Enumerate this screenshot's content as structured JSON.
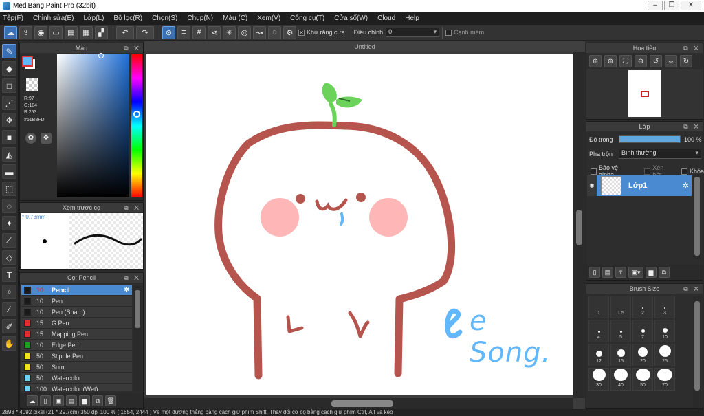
{
  "window": {
    "title": "MediBang Paint Pro (32bit)",
    "minimize": "–",
    "maximize": "❐",
    "close": "✕"
  },
  "menu": [
    "Tệp(F)",
    "Chỉnh sửa(E)",
    "Lớp(L)",
    "Bộ lọc(R)",
    "Chọn(S)",
    "Chụp(N)",
    "Màu (C)",
    "Xem(V)",
    "Công cụ(T)",
    "Cửa sổ(W)",
    "Cloud",
    "Help"
  ],
  "toolbar": {
    "antialias_label": "Khử răng cưa",
    "adjust_label": "Điều chỉnh",
    "adjust_value": "0",
    "smooth_label": "Cạnh mềm"
  },
  "color_panel": {
    "title": "Màu",
    "r": "R:97",
    "g": "G:184",
    "b": "B:253",
    "hex": "#61B8FD",
    "fg_color": "#61B8FD"
  },
  "brush_preview": {
    "title": "Xem trước cọ",
    "size": "* 0.73mm"
  },
  "brush_panel": {
    "title": "Cọ: Pencil",
    "items": [
      {
        "size": "10",
        "name": "Pencil",
        "color": "#1a1a1a"
      },
      {
        "size": "10",
        "name": "Pen",
        "color": "#1a1a1a"
      },
      {
        "size": "10",
        "name": "Pen (Sharp)",
        "color": "#1a1a1a"
      },
      {
        "size": "15",
        "name": "G Pen",
        "color": "#e03030"
      },
      {
        "size": "15",
        "name": "Mapping Pen",
        "color": "#e03030"
      },
      {
        "size": "10",
        "name": "Edge Pen",
        "color": "#20a020"
      },
      {
        "size": "50",
        "name": "Stipple Pen",
        "color": "#f0e020"
      },
      {
        "size": "50",
        "name": "Sumi",
        "color": "#f0e020"
      },
      {
        "size": "50",
        "name": "Watercolor",
        "color": "#70d0f0"
      },
      {
        "size": "100",
        "name": "Watercolor (Wet)",
        "color": "#70d0f0"
      }
    ]
  },
  "document": {
    "tab": "Untitled",
    "signature": "e Song."
  },
  "navigator": {
    "title": "Hoa tiêu"
  },
  "layer_panel": {
    "title": "Lớp",
    "opacity_label": "Độ trong",
    "opacity_value": "100 %",
    "opacity_fraction": 1.0,
    "blend_label": "Pha trộn",
    "blend_value": "Bình thường",
    "protect_alpha": "Bảo vệ alpha",
    "clip": "Xén bớt",
    "lock": "Khóa",
    "layers": [
      {
        "name": "Lớp1"
      }
    ]
  },
  "brush_size_panel": {
    "title": "Brush Size",
    "sizes": [
      "1",
      "1.5",
      "2",
      "3",
      "4",
      "5",
      "7",
      "10",
      "12",
      "15",
      "20",
      "25",
      "30",
      "40",
      "50",
      "70"
    ]
  },
  "status": "2893 * 4092 pixel   (21 * 29.7cm)   350 dpi   100 %   ( 1654, 2444 )   Vẽ một đường thẳng bằng cách giữ phím Shift, Thay đổi cỡ cọ bằng cách giữ phím Ctrl, Alt và kéo"
}
